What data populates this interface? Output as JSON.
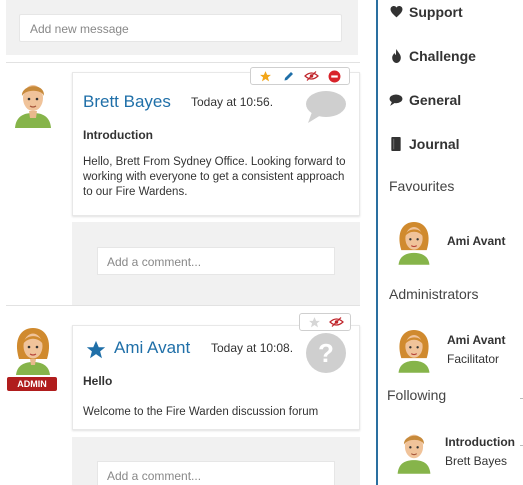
{
  "composer": {
    "placeholder": "Add new message"
  },
  "posts": [
    {
      "author": "Brett Bayes",
      "time": "Today at 10:56.",
      "subject": "Introduction",
      "body": "Hello, Brett From Sydney Office. Looking forward to working with everyone to get a consistent approach to our Fire Wardens.",
      "comment_placeholder": "Add a comment...",
      "starred": true
    },
    {
      "author": "Ami Avant",
      "time": "Today at 10:08.",
      "subject": "Hello",
      "body": "Welcome to the Fire Warden discussion forum",
      "comment_placeholder": "Add a comment...",
      "badge": "ADMIN",
      "starred": true
    }
  ],
  "sidebar": {
    "nav": [
      {
        "label": "Support",
        "icon": "heart-icon"
      },
      {
        "label": "Challenge",
        "icon": "flame-icon"
      },
      {
        "label": "General",
        "icon": "speech-bubble-icon"
      },
      {
        "label": "Journal",
        "icon": "book-icon"
      }
    ],
    "favourites": {
      "heading": "Favourites",
      "items": [
        {
          "name": "Ami Avant"
        }
      ]
    },
    "administrators": {
      "heading": "Administrators",
      "items": [
        {
          "name": "Ami Avant",
          "role": "Facilitator"
        }
      ]
    },
    "following": {
      "heading": "Following",
      "items": [
        {
          "title": "Introduction",
          "name": "Brett Bayes"
        }
      ]
    }
  },
  "colors": {
    "accent": "#1f6fa8",
    "admin_badge": "#b01d1d",
    "star": "#f2a619",
    "delete": "#d8232a",
    "sidebar_border": "#2a6fa0"
  }
}
